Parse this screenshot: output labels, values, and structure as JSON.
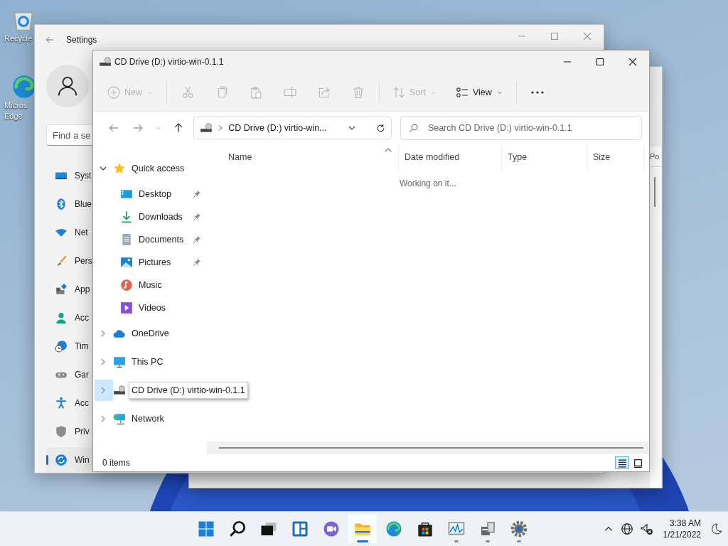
{
  "desktop": {
    "icons": [
      {
        "kind": "recycle-bin",
        "lines": [
          "Recycle"
        ]
      },
      {
        "kind": "edge",
        "lines": [
          "Micros",
          "Edge"
        ]
      }
    ]
  },
  "settings": {
    "title": "Settings",
    "search": {
      "placeholder": "Find a se"
    },
    "nav": [
      {
        "kind": "system",
        "label": "Syst",
        "selected": false
      },
      {
        "kind": "bluetooth",
        "label": "Blue",
        "selected": false
      },
      {
        "kind": "wifi",
        "label": "Net",
        "selected": false
      },
      {
        "kind": "brush",
        "label": "Pers",
        "selected": false
      },
      {
        "kind": "apps",
        "label": "App",
        "selected": false
      },
      {
        "kind": "person",
        "label": "Acc",
        "selected": false
      },
      {
        "kind": "clock",
        "label": "Tim",
        "selected": false
      },
      {
        "kind": "gamepad",
        "label": "Gar",
        "selected": false
      },
      {
        "kind": "accessibility",
        "label": "Acc",
        "selected": false
      },
      {
        "kind": "shield",
        "label": "Priv",
        "selected": false
      },
      {
        "kind": "update",
        "label": "Win",
        "selected": true
      }
    ]
  },
  "task_manager": {
    "column_5": "Po"
  },
  "explorer": {
    "title": "CD Drive (D:) virtio-win-0.1.1",
    "toolbar": [
      {
        "kind": "new",
        "label": "New",
        "disabled": true
      },
      {
        "kind": "separator"
      },
      {
        "kind": "cut",
        "disabled": true
      },
      {
        "kind": "copy",
        "disabled": true
      },
      {
        "kind": "paste",
        "disabled": true
      },
      {
        "kind": "rename",
        "disabled": true
      },
      {
        "kind": "share",
        "disabled": true
      },
      {
        "kind": "delete",
        "disabled": true
      },
      {
        "kind": "separator"
      },
      {
        "kind": "sort",
        "label": "Sort",
        "disabled": true
      },
      {
        "kind": "view",
        "label": "View",
        "disabled": false
      },
      {
        "kind": "separator"
      },
      {
        "kind": "more"
      }
    ],
    "address": {
      "path": "CD Drive (D:) virtio-win..."
    },
    "search": {
      "placeholder": "Search CD Drive (D:) virtio-win-0.1.1"
    },
    "tree": [
      {
        "kind": "star",
        "label": "Quick access",
        "expanded": true,
        "selected": false,
        "children": [
          {
            "kind": "desktop",
            "label": "Desktop",
            "pinned": true,
            "selected": false
          },
          {
            "kind": "download",
            "label": "Downloads",
            "pinned": true,
            "selected": false
          },
          {
            "kind": "document",
            "label": "Documents",
            "pinned": true,
            "selected": false
          },
          {
            "kind": "picture",
            "label": "Pictures",
            "pinned": true,
            "selected": false
          },
          {
            "kind": "music",
            "label": "Music",
            "pinned": false,
            "selected": false
          },
          {
            "kind": "video",
            "label": "Videos",
            "pinned": false,
            "selected": false
          }
        ]
      },
      {
        "kind": "cloud",
        "label": "OneDrive",
        "expanded": false,
        "selected": false
      },
      {
        "kind": "monitor",
        "label": "This PC",
        "expanded": false,
        "selected": false
      },
      {
        "kind": "drive",
        "label": "CD Drive (D:) virtio-win-0.1.1",
        "expanded": false,
        "selected": true
      },
      {
        "kind": "network",
        "label": "Network",
        "expanded": false,
        "selected": false
      }
    ],
    "columns": [
      {
        "label": "Name",
        "sorted": true
      },
      {
        "label": "Date modified",
        "sorted": false
      },
      {
        "label": "Type",
        "sorted": false
      },
      {
        "label": "Size",
        "sorted": false
      }
    ],
    "status_message": "Working on it...",
    "status_bar": {
      "count": "0 items",
      "views": [
        {
          "kind": "details",
          "selected": true
        },
        {
          "kind": "tiles",
          "selected": false
        }
      ]
    }
  },
  "taskbar": {
    "apps": [
      {
        "kind": "start",
        "running": false,
        "active": false
      },
      {
        "kind": "search",
        "running": false,
        "active": false
      },
      {
        "kind": "task-view",
        "running": false,
        "active": false
      },
      {
        "kind": "widgets",
        "running": false,
        "active": false
      },
      {
        "kind": "chat",
        "running": false,
        "active": false
      },
      {
        "kind": "folder",
        "running": true,
        "active": true
      },
      {
        "kind": "edge",
        "running": false,
        "active": false
      },
      {
        "kind": "store",
        "running": false,
        "active": false
      },
      {
        "kind": "chart",
        "running": true,
        "active": false
      },
      {
        "kind": "device",
        "running": true,
        "active": false
      },
      {
        "kind": "gear",
        "running": true,
        "active": false
      }
    ],
    "time": "3:38 AM",
    "date": "1/21/2022"
  }
}
